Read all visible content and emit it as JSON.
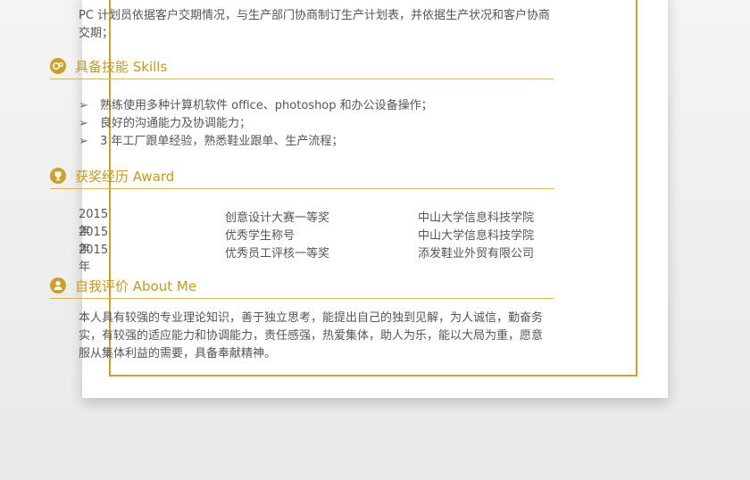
{
  "top_text": "PC 计划员依据客户交期情况，与生产部门协商制订生产计划表，并依据生产状况和客户协商交期；",
  "skills": {
    "title": "具备技能  Skills",
    "items": [
      "熟练使用多种计算机软件 office、photoshop 和办公设备操作；",
      "良好的沟通能力及协调能力；",
      "3 年工厂跟单经验，熟悉鞋业跟单、生产流程；"
    ],
    "bullet": "➢"
  },
  "awards": {
    "title": "获奖经历  Award",
    "rows": [
      {
        "year": "2015 年",
        "name": "创意设计大赛一等奖",
        "org": "中山大学信息科技学院"
      },
      {
        "year": "2015 年",
        "name": "优秀学生称号",
        "org": "中山大学信息科技学院"
      },
      {
        "year": "2015 年",
        "name": "优秀员工评核一等奖",
        "org": "添发鞋业外贸有限公司"
      }
    ]
  },
  "about": {
    "title": "自我评价  About Me",
    "text": "本人具有较强的专业理论知识，善于独立思考，能提出自己的独到见解，为人诚信，勤奋务实，有较强的适应能力和协调能力，责任感强，热爱集体，助人为乐，能以大局为重，愿意服从集体利益的需要，具备奉献精神。"
  },
  "colors": {
    "accent": "#c9a227"
  }
}
